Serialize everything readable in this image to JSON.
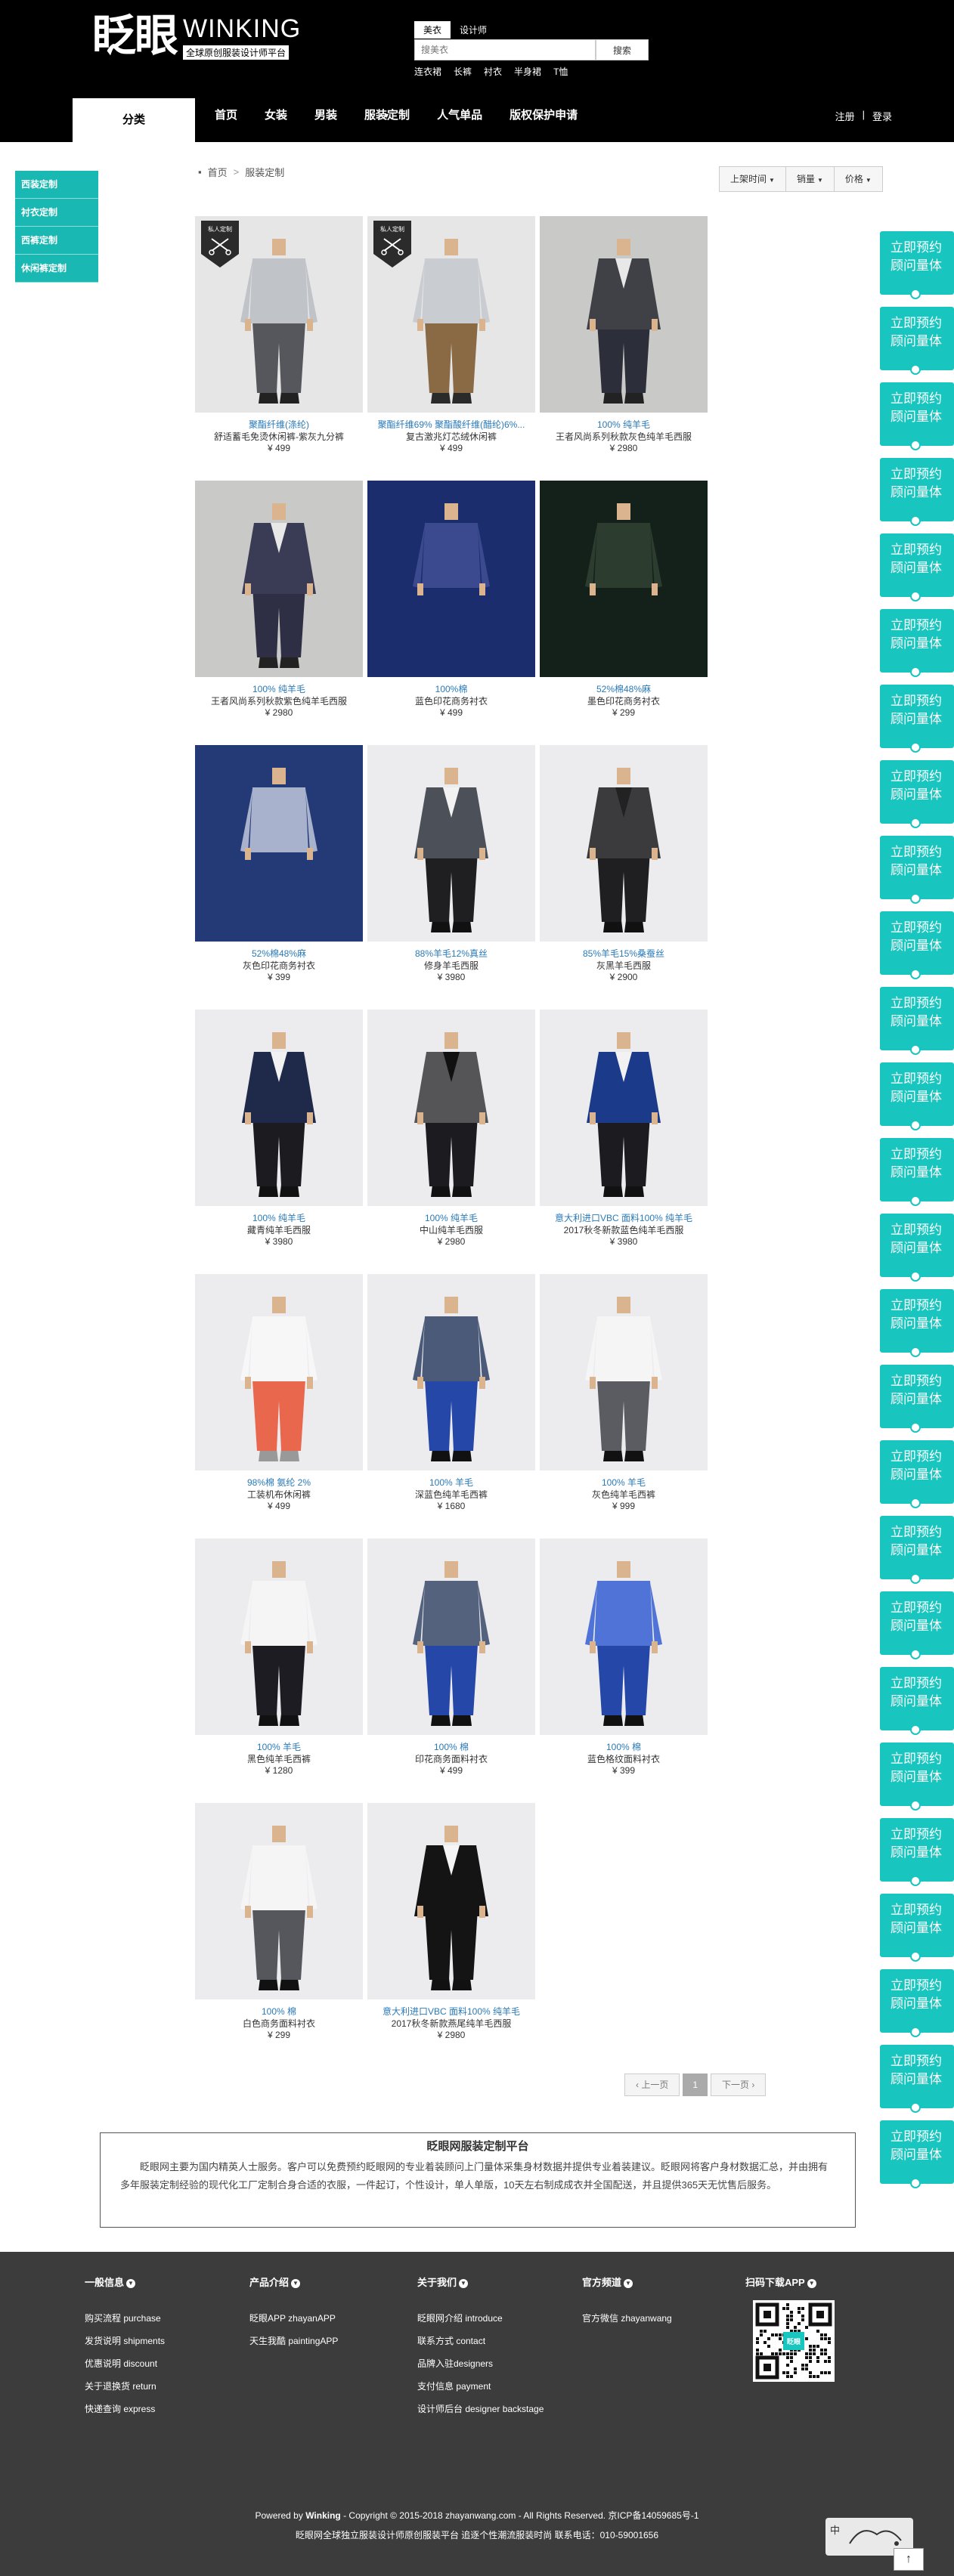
{
  "header": {
    "logo_cn": "眨眼",
    "logo_en": "WINKING",
    "logo_tagline": "全球原创服装设计师平台",
    "search_tabs": [
      "美衣",
      "设计师"
    ],
    "search_placeholder": "搜美衣",
    "search_button": "搜索",
    "hot_words": [
      "连衣裙",
      "长裤",
      "衬衣",
      "半身裙",
      "T恤"
    ]
  },
  "nav": {
    "category": "分类",
    "items": [
      "首页",
      "女装",
      "男装",
      "服装定制",
      "人气单品",
      "版权保护申请"
    ],
    "login": "注册",
    "separator": "|",
    "register": "登录"
  },
  "sidebar": {
    "items": [
      "西装定制",
      "衬衣定制",
      "西裤定制",
      "休闲裤定制"
    ]
  },
  "breadcrumb": {
    "home": "首页",
    "sep": ">",
    "current": "服装定制"
  },
  "sort": {
    "options": [
      "上架时间",
      "销量",
      "价格"
    ]
  },
  "badge_text": "私人定制",
  "products": [
    {
      "material": "聚酯纤维(涤纶)",
      "name": "舒适蓄毛免烫休闲裤-紫灰九分裤",
      "price": "¥ 499",
      "badge": true,
      "colors": {
        "bg": "#e6e6e6",
        "top": "#c0c4c8",
        "jacket": "",
        "pants": "#55575c",
        "shoe": "#222"
      }
    },
    {
      "material": "聚酯纤维69% 聚酯酸纤维(醋纶)6%...",
      "name": "复古激兆灯芯绒休闲裤",
      "price": "¥ 499",
      "badge": true,
      "colors": {
        "bg": "#e6e6e6",
        "top": "#c9ccd0",
        "jacket": "",
        "pants": "#8a6a45",
        "shoe": "#2a2a2a"
      }
    },
    {
      "material": "100% 纯羊毛",
      "name": "王者风尚系列秋款灰色纯羊毛西服",
      "price": "¥ 2980",
      "badge": false,
      "colors": {
        "bg": "#c9c9c7",
        "top": "#e8e8e8",
        "jacket": "#3f4147",
        "pants": "#2c2f3a",
        "shoe": "#222"
      }
    },
    {
      "material": "100% 纯羊毛",
      "name": "王者风尚系列秋款紫色纯羊毛西服",
      "price": "¥ 2980",
      "badge": false,
      "colors": {
        "bg": "#c9c9c7",
        "top": "#e8e8e8",
        "jacket": "#3a3b55",
        "pants": "#2e2f45",
        "shoe": "#222"
      }
    },
    {
      "material": "100%棉",
      "name": "蓝色印花商务衬衣",
      "price": "¥ 499",
      "badge": false,
      "colors": {
        "bg": "#1c2d6e",
        "top": "#3b4a8f",
        "jacket": "",
        "pants": "#1c2d6e",
        "shoe": "#1c2d6e"
      }
    },
    {
      "material": "52%棉48%麻",
      "name": "墨色印花商务衬衣",
      "price": "¥ 299",
      "badge": false,
      "colors": {
        "bg": "#14201a",
        "top": "#2c3d30",
        "jacket": "",
        "pants": "#14201a",
        "shoe": "#14201a"
      }
    },
    {
      "material": "52%棉48%麻",
      "name": "灰色印花商务衬衣",
      "price": "¥ 399",
      "badge": false,
      "colors": {
        "bg": "#233a76",
        "top": "#a9b2cc",
        "jacket": "",
        "pants": "#233a76",
        "shoe": "#233a76"
      }
    },
    {
      "material": "88%羊毛12%真丝",
      "name": "修身羊毛西服",
      "price": "¥ 3980",
      "badge": false,
      "colors": {
        "bg": "#ececef",
        "top": "#f2f2f2",
        "jacket": "#4c5058",
        "pants": "#1f1f22",
        "shoe": "#111"
      }
    },
    {
      "material": "85%羊毛15%桑蚕丝",
      "name": "灰黑羊毛西服",
      "price": "¥ 2900",
      "badge": false,
      "colors": {
        "bg": "#ececef",
        "top": "#222",
        "jacket": "#3b3b3d",
        "pants": "#1f1f22",
        "shoe": "#111"
      }
    },
    {
      "material": "100% 纯羊毛",
      "name": "藏青纯羊毛西服",
      "price": "¥ 3980",
      "badge": false,
      "colors": {
        "bg": "#ececef",
        "top": "#f2f2f2",
        "jacket": "#1f2a4a",
        "pants": "#1b1b20",
        "shoe": "#111"
      }
    },
    {
      "material": "100% 纯羊毛",
      "name": "中山纯羊毛西服",
      "price": "¥ 2980",
      "badge": false,
      "colors": {
        "bg": "#ececef",
        "top": "#111",
        "jacket": "#555558",
        "pants": "#1b1b20",
        "shoe": "#111"
      }
    },
    {
      "material": "意大利进口VBC 面料100% 纯羊毛",
      "name": "2017秋冬新款蓝色纯羊毛西服",
      "price": "¥ 3980",
      "badge": false,
      "colors": {
        "bg": "#ececef",
        "top": "#f2f2f2",
        "jacket": "#1b3a8a",
        "pants": "#1b1b20",
        "shoe": "#111"
      }
    },
    {
      "material": "98%棉 氨纶 2%",
      "name": "工装机布休闲裤",
      "price": "¥ 499",
      "badge": false,
      "colors": {
        "bg": "#ececef",
        "top": "#f7f7f7",
        "jacket": "",
        "pants": "#e8674d",
        "shoe": "#999"
      }
    },
    {
      "material": "100% 羊毛",
      "name": "深蓝色纯羊毛西裤",
      "price": "¥ 1680",
      "badge": false,
      "colors": {
        "bg": "#ececef",
        "top": "#4c5a7a",
        "jacket": "",
        "pants": "#2447a8",
        "shoe": "#111"
      }
    },
    {
      "material": "100% 羊毛",
      "name": "灰色纯羊毛西裤",
      "price": "¥ 999",
      "badge": false,
      "colors": {
        "bg": "#ececef",
        "top": "#f5f5f5",
        "jacket": "",
        "pants": "#5a5c62",
        "shoe": "#111"
      }
    },
    {
      "material": "100% 羊毛",
      "name": "黑色纯羊毛西裤",
      "price": "¥ 1280",
      "badge": false,
      "colors": {
        "bg": "#ececef",
        "top": "#f5f5f5",
        "jacket": "",
        "pants": "#1c1c22",
        "shoe": "#111"
      }
    },
    {
      "material": "100% 棉",
      "name": "印花商务面料衬衣",
      "price": "¥ 499",
      "badge": false,
      "colors": {
        "bg": "#ececef",
        "top": "#55627e",
        "jacket": "",
        "pants": "#2447a8",
        "shoe": "#111"
      }
    },
    {
      "material": "100% 棉",
      "name": "蓝色格纹面料衬衣",
      "price": "¥ 399",
      "badge": false,
      "colors": {
        "bg": "#ececef",
        "top": "#4f73d6",
        "jacket": "",
        "pants": "#2447a8",
        "shoe": "#111"
      }
    },
    {
      "material": "100% 棉",
      "name": "白色商务面料衬衣",
      "price": "¥ 299",
      "badge": false,
      "colors": {
        "bg": "#ececef",
        "top": "#f5f5f5",
        "jacket": "",
        "pants": "#55575c",
        "shoe": "#111"
      }
    },
    {
      "material": "意大利进口VBC 面料100% 纯羊毛",
      "name": "2017秋冬新款燕尾纯羊毛西服",
      "price": "¥ 2980",
      "badge": false,
      "colors": {
        "bg": "#ececef",
        "top": "#f5f5f5",
        "jacket": "#141414",
        "pants": "#141414",
        "shoe": "#111"
      }
    }
  ],
  "pager": {
    "prev": "‹ 上一页",
    "current": "1",
    "next": "下一页 ›"
  },
  "appointment": {
    "label": "立即预约顾问量体",
    "count": 26
  },
  "intro": {
    "title": "眨眼网服装定制平台",
    "text": "眨眼网主要为国内精英人士服务。客户可以免费预约眨眼网的专业着装顾问上门量体采集身材数据并提供专业着装建议。眨眼网将客户身材数据汇总，并由拥有多年服装定制经验的现代化工厂定制合身合适的衣服，一件起订，个性设计，单人单版，10天左右制成成衣并全国配送，并且提供365天无忧售后服务。"
  },
  "footer": {
    "columns": [
      {
        "title": "一般信息",
        "links": [
          "购买流程 purchase",
          "发货说明 shipments",
          "优惠说明 discount",
          "关于退换货 return",
          "快递查询 express"
        ]
      },
      {
        "title": "产品介绍",
        "links": [
          "眨眼APP zhayanAPP",
          "天生我酷 paintingAPP"
        ]
      },
      {
        "title": "关于我们",
        "links": [
          "眨眼网介绍 introduce",
          "联系方式 contact",
          "品牌入驻designers",
          "支付信息 payment",
          "设计师后台 designer backstage"
        ]
      },
      {
        "title": "官方频道",
        "links": [
          "官方微信 zhayanwang"
        ]
      },
      {
        "title": "扫码下载APP",
        "links": []
      }
    ],
    "copyright_line1_pre": "Powered by ",
    "copyright_brand": "Winking",
    "copyright_line1_post": " - Copyright © 2015-2018 zhayanwang.com - All Rights Reserved.   京ICP备14059685号-1",
    "copyright_line2": "眨眼网全球独立服装设计师原创服装平台 追逐个性潮流服装时尚     联系电话：010-59001656",
    "qr_label": "眨眼"
  },
  "float_widget": {
    "lang": "中",
    "back_top": "↑"
  }
}
